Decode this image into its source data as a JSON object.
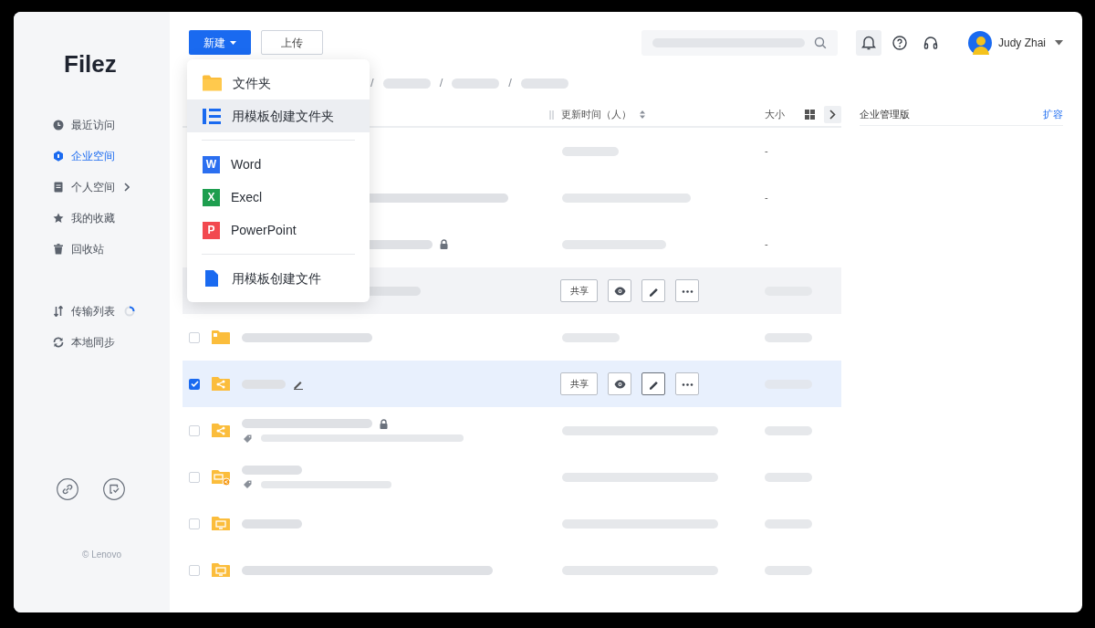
{
  "sidebar": {
    "logo": "Filez",
    "nav_groups": [
      [
        {
          "label": "最近访问",
          "selected": false,
          "expandable": false,
          "busy": false
        },
        {
          "label": "企业空间",
          "selected": true,
          "expandable": false,
          "busy": false
        },
        {
          "label": "个人空间",
          "selected": false,
          "expandable": true,
          "busy": false
        },
        {
          "label": "我的收藏",
          "selected": false,
          "expandable": false,
          "busy": false
        },
        {
          "label": "回收站",
          "selected": false,
          "expandable": false,
          "busy": false
        }
      ],
      [
        {
          "label": "传输列表",
          "selected": false,
          "expandable": false,
          "busy": true
        },
        {
          "label": "本地同步",
          "selected": false,
          "expandable": false,
          "busy": false
        }
      ]
    ],
    "footer_actions": [
      {
        "kind": "link"
      },
      {
        "kind": "tasks"
      }
    ],
    "copyright": "© Lenovo"
  },
  "toolbar": {
    "new_button": "新建",
    "upload_button": "上传"
  },
  "header_actions": [
    {
      "kind": "bell",
      "selected": true
    },
    {
      "kind": "help",
      "selected": false
    },
    {
      "kind": "headset",
      "selected": false
    }
  ],
  "user": {
    "name": "Judy Zhai"
  },
  "breadcrumb": {
    "separators": [
      "/",
      "/",
      "/"
    ]
  },
  "table": {
    "columns": [
      {
        "label": "更新时间（人）",
        "sortable": true
      },
      {
        "label": "大小",
        "sortable": false
      }
    ],
    "rows": [
      {
        "selected": false,
        "hovered": false,
        "locked": false,
        "renaming": false,
        "tagged": false,
        "size": "-"
      },
      {
        "selected": false,
        "hovered": false,
        "locked": false,
        "renaming": false,
        "tagged": false,
        "size": "-"
      },
      {
        "selected": false,
        "hovered": false,
        "locked": true,
        "renaming": false,
        "tagged": false,
        "size": "-"
      },
      {
        "selected": false,
        "hovered": true,
        "locked": false,
        "renaming": false,
        "tagged": false,
        "actions": [
          {
            "kind": "text",
            "label": "共享"
          },
          {
            "kind": "view"
          },
          {
            "kind": "edit"
          },
          {
            "kind": "more"
          }
        ]
      },
      {
        "kind": "folder",
        "checked": false,
        "selected": false,
        "hovered": false,
        "locked": false,
        "renaming": false,
        "tagged": false
      },
      {
        "kind": "shared",
        "checked": true,
        "selected": true,
        "hovered": false,
        "locked": false,
        "renaming": true,
        "tagged": false,
        "actions": [
          {
            "kind": "text",
            "label": "共享"
          },
          {
            "kind": "view"
          },
          {
            "kind": "edit"
          },
          {
            "kind": "more"
          }
        ]
      },
      {
        "kind": "shared",
        "checked": false,
        "selected": false,
        "hovered": false,
        "locked": true,
        "renaming": false,
        "tagged": true
      },
      {
        "kind": "screenshared",
        "checked": false,
        "selected": false,
        "hovered": false,
        "locked": false,
        "renaming": false,
        "tagged": true
      },
      {
        "kind": "screen",
        "checked": false,
        "selected": false,
        "hovered": false,
        "locked": false,
        "renaming": false,
        "tagged": false
      },
      {
        "kind": "screen",
        "checked": false,
        "selected": false,
        "hovered": false,
        "locked": false,
        "renaming": false,
        "tagged": false
      }
    ]
  },
  "side_panel": {
    "title": "企业管理版",
    "link": "扩容"
  },
  "new_menu": {
    "items": [
      {
        "kind": "folder",
        "label": "文件夹",
        "hovered": false
      },
      {
        "kind": "template",
        "label": "用模板创建文件夹",
        "hovered": true
      },
      {
        "kind": "divider"
      },
      {
        "kind": "badge",
        "badge": "W",
        "color": "#2b6ff0",
        "label": "Word",
        "hovered": false
      },
      {
        "kind": "badge",
        "badge": "X",
        "color": "#1e9e4f",
        "label": "Execl",
        "hovered": false
      },
      {
        "kind": "badge",
        "badge": "P",
        "color": "#f2494f",
        "label": "PowerPoint",
        "hovered": false
      },
      {
        "kind": "divider"
      },
      {
        "kind": "document",
        "label": "用模板创建文件",
        "hovered": false
      }
    ]
  }
}
